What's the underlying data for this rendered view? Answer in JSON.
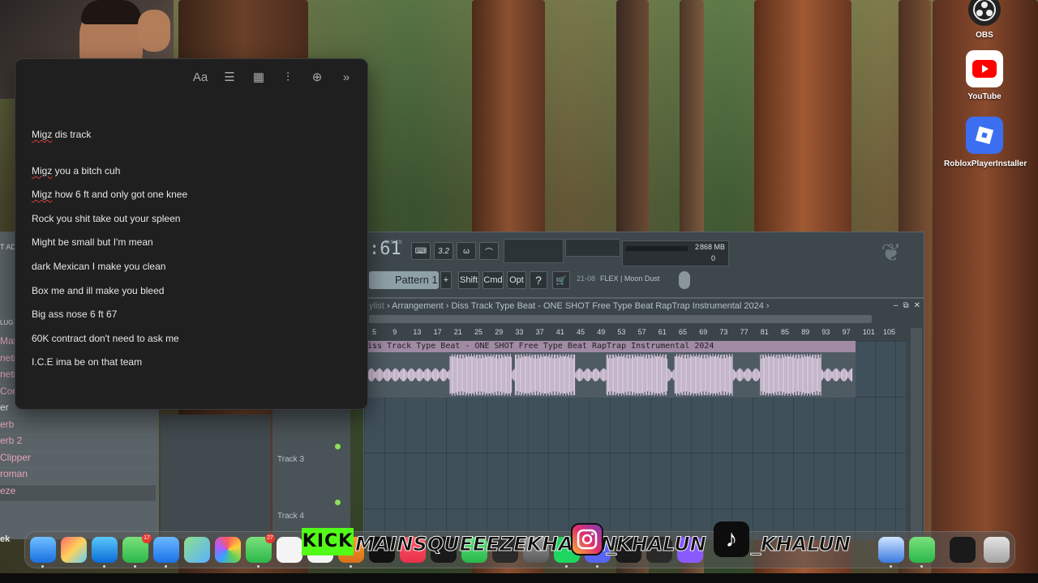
{
  "notes": {
    "toolbar_icons": [
      "text-format-icon",
      "checklist-icon",
      "table-icon",
      "audio-icon",
      "share-icon",
      "more-icon"
    ],
    "toolbar_glyphs": [
      "Aa",
      "☰",
      "▦",
      "⫶",
      "⊕",
      "»"
    ],
    "lines": [
      "Migz dis track",
      "Migz you a bitch cuh",
      "Migz how 6 ft and only got one knee",
      "Rock you shit take out your spleen",
      "Might be small but I'm mean",
      "dark Mexican I make you clean",
      "Box me and ill make you bleed",
      "Big ass nose 6 ft 67",
      "60K contract don't need to ask me",
      "I.C.E ima be on that team"
    ]
  },
  "fl": {
    "time": ":61",
    "time_unit": "M:S:CS",
    "top_buttons": [
      "⌨",
      "3.2",
      "ω",
      "⌒"
    ],
    "cpu_value": "2",
    "memory": "868 MB",
    "poly": "0",
    "pattern": "Pattern 1",
    "pattern_add": "+",
    "mod_buttons": [
      "Shift",
      "Cmd",
      "Opt"
    ],
    "ticker_num": "21-08",
    "ticker_text": "FLEX | Moon Dust",
    "left_header": "T AD",
    "left_label": "LUG",
    "mixer_items": [
      "Mat",
      "netr",
      "netr",
      "Con",
      "er",
      "erb",
      "erb 2",
      "Clipper",
      "roman",
      "eze"
    ],
    "left_bottom": "ek",
    "playlist_title_dim": "ylist",
    "playlist_path": "› Arrangement › Diss Track Type Beat - ONE SHOT  Free Type Beat  RapTrap Instrumental 2024 ›",
    "playlist_controls": [
      "–",
      "⧉",
      "✕"
    ],
    "ruler": [
      "5",
      "9",
      "13",
      "17",
      "21",
      "25",
      "29",
      "33",
      "37",
      "41",
      "45",
      "49",
      "53",
      "57",
      "61",
      "65",
      "69",
      "73",
      "77",
      "81",
      "85",
      "89",
      "93",
      "97",
      "101",
      "105"
    ],
    "clip_name": "iss Track Type Beat - ONE SHOT  Free Type Beat  RapTrap Instrumental 2024",
    "track_labels": [
      "Track 3",
      "Track 4"
    ]
  },
  "desktop": {
    "icons": [
      {
        "name": "OBS",
        "icon": "obs-icon"
      },
      {
        "name": "YouTube",
        "icon": "youtube-icon"
      },
      {
        "name": "RobloxPlayerInstaller",
        "icon": "roblox-icon"
      }
    ]
  },
  "dock": {
    "messages_badge": "27",
    "messages_badge2": "17"
  },
  "overlay": {
    "kick": "KICK",
    "kick_handle": "MAINSQUEEEZEKHALUN",
    "instagram_handle": "_KHALUN",
    "tiktok_handle": "_KHALUN",
    "tiktok_glyph": "♪"
  }
}
